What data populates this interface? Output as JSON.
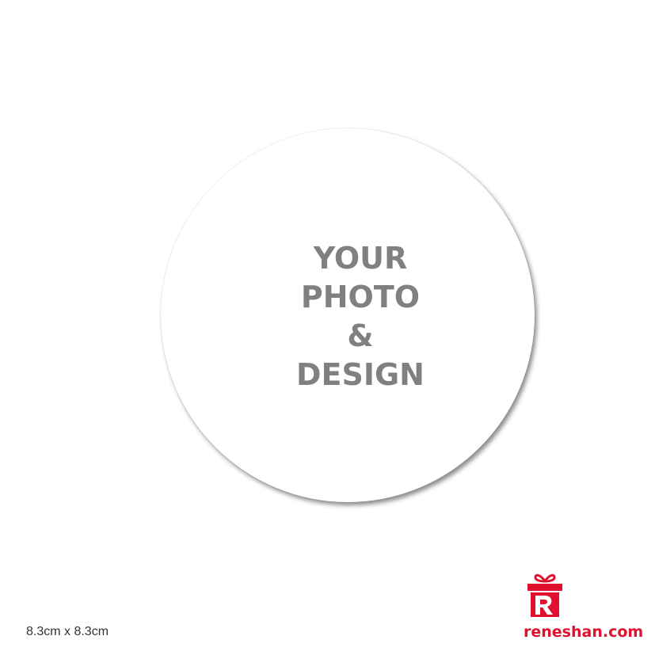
{
  "placeholder": {
    "lines": [
      "YOUR",
      "PHOTO",
      "&",
      "DESIGN"
    ]
  },
  "size_label": "8.3cm x 8.3cm",
  "logo": {
    "text": "reneshan.com",
    "icon": "gift-box-r-logo-icon"
  },
  "colors": {
    "background": "#ffffff",
    "coaster": "#ffffff",
    "placeholder_text": "#808080",
    "brand": "#e0102f"
  }
}
